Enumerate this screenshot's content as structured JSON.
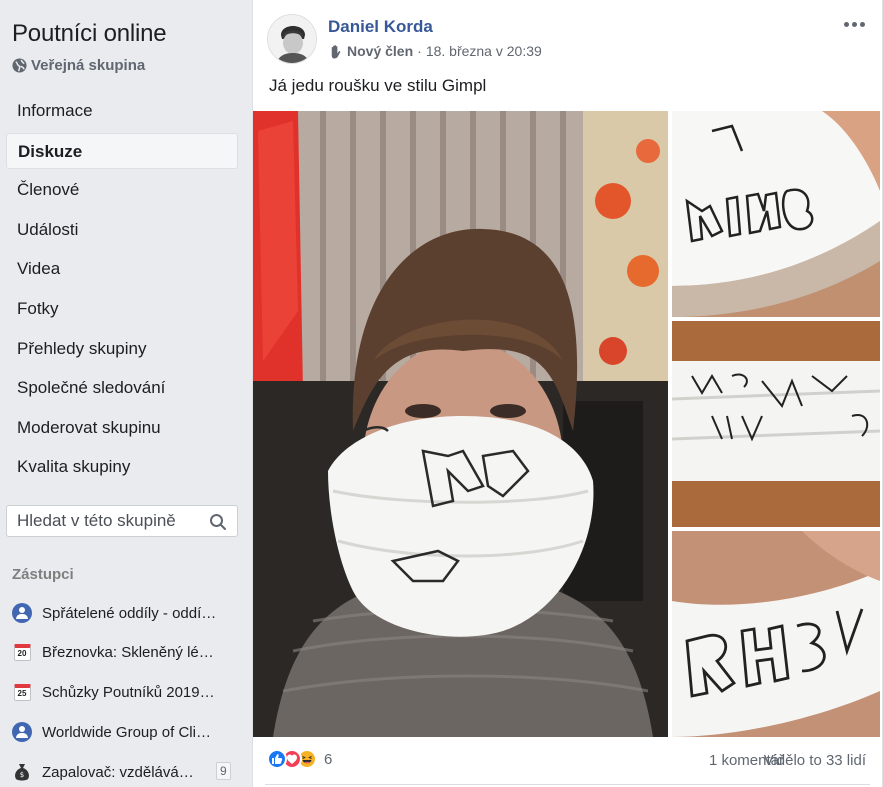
{
  "sidebar": {
    "group_name": "Poutníci online",
    "privacy": "Veřejná skupina",
    "nav": [
      {
        "label": "Informace",
        "active": false
      },
      {
        "label": "Diskuze",
        "active": true
      },
      {
        "label": "Členové",
        "active": false
      },
      {
        "label": "Události",
        "active": false
      },
      {
        "label": "Videa",
        "active": false
      },
      {
        "label": "Fotky",
        "active": false
      },
      {
        "label": "Přehledy skupiny",
        "active": false
      },
      {
        "label": "Společné sledování",
        "active": false
      },
      {
        "label": "Moderovat skupinu",
        "active": false
      },
      {
        "label": "Kvalita skupiny",
        "active": false
      }
    ],
    "search_placeholder": "Hledat v této skupině",
    "shortcuts_title": "Zástupci",
    "shortcuts": [
      {
        "label": "Spřátelené oddíly - oddí…",
        "icon": "group-icon"
      },
      {
        "label": "Březnovka: Skleněný lé…",
        "icon": "calendar-icon",
        "day": "20"
      },
      {
        "label": "Schůzky Poutníků 2019…",
        "icon": "calendar-icon",
        "day": "25"
      },
      {
        "label": "Worldwide Group of Cli…",
        "icon": "group-icon"
      },
      {
        "label": "Zapalovač: vzdělává…",
        "icon": "money-bag-icon",
        "badge": "9"
      }
    ]
  },
  "post": {
    "author": "Daniel Korda",
    "member_badge": "Nový člen",
    "separator": "·",
    "timestamp": "18. března v 20:39",
    "text": "Já jedu roušku ve stilu Gimpl",
    "photos": [
      {
        "name": "selfie-with-mask"
      },
      {
        "name": "mask-king-closeup"
      },
      {
        "name": "mask-fold-closeup"
      },
      {
        "name": "mask-rhs-closeup"
      }
    ],
    "reactions": {
      "types": [
        "like",
        "love",
        "haha"
      ],
      "count": "6"
    },
    "comments": "1 komentář",
    "seen_by": "Vidělo to 33 lidí"
  }
}
